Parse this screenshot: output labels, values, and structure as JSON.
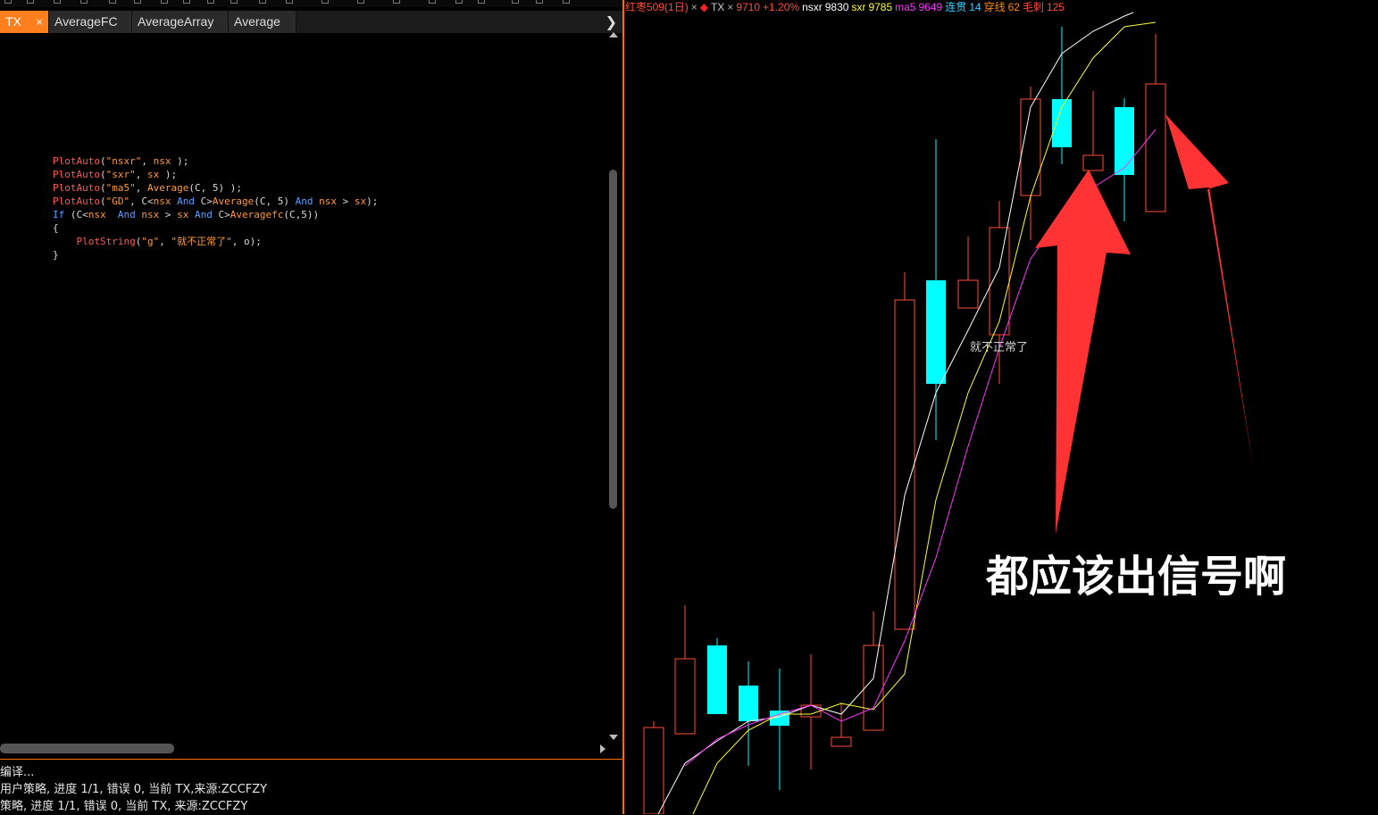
{
  "editor": {
    "tabs": [
      {
        "label": "TX",
        "close": "×",
        "active": true
      },
      {
        "label": "AverageFC",
        "active": false
      },
      {
        "label": "AverageArray",
        "active": false
      },
      {
        "label": "Average",
        "active": false
      }
    ],
    "tab_scroll_icon": "chevron-right-icon",
    "code_lines": [
      "PlotAuto(\"nsxr\", nsx );",
      "PlotAuto(\"sxr\", sx );",
      "PlotAuto(\"ma5\", Average(C, 5) );",
      "PlotAuto(\"GD\", C<nsx And C>Average(C, 5) And nsx > sx);",
      "",
      "",
      "If (C<nsx  And nsx > sx And C>Averagefc(C,5))",
      "{",
      "    PlotString(\"g\", \"就不正常了\", o);",
      "}"
    ]
  },
  "output": {
    "lines": [
      "编译...",
      "用户策略, 进度 1/1, 错误 0, 当前 TX,来源:ZCCFZY",
      "策略, 进度 1/1, 错误 0, 当前 TX, 来源:ZCCFZY"
    ]
  },
  "chart": {
    "symbol": "红枣509(1日)",
    "close_icon_1": "×",
    "indicator": "TX",
    "close_icon_2": "×",
    "price": "9710",
    "change": "+1.20%",
    "nsxr_label": "nsxr",
    "nsxr_value": "9830",
    "sxr_label": "sxr",
    "sxr_value": "9785",
    "ma5_label": "ma5",
    "ma5_value": "9649",
    "lianguan_label": "连贯",
    "lianguan_value": "14",
    "chuanxian_label": "穿线",
    "chuanxian_value": "62",
    "maoci_label": "毛刺",
    "maoci_value": "125",
    "plotstring_text": "就不正常了",
    "annotation_caption": "都应该出信号啊",
    "colors": {
      "up": "#ff4b3a",
      "down": "#00ffff",
      "nsxr": "#ffffff",
      "sxr": "#ffff33",
      "ma5": "#ff33ff",
      "arrow": "#ff3333"
    }
  },
  "chart_data": {
    "type": "candlestick",
    "series": [
      {
        "name": "nsxr"
      },
      {
        "name": "sxr"
      },
      {
        "name": "ma5"
      }
    ]
  }
}
